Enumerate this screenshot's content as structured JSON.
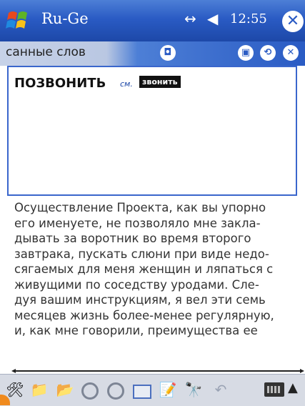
{
  "titlebar": {
    "app_title": "Ru-Ge",
    "time": "12:55",
    "connectivity_icon": "↔",
    "volume_icon": "◀",
    "close_label": "✕"
  },
  "window": {
    "caption": "санные слов"
  },
  "entry": {
    "headword": "ПОЗВОНИТЬ",
    "see_label": "см.",
    "xref": "звонить"
  },
  "body_lines": [
    "Осуществление Проекта, как вы упорно",
    "его именуете, не позволяло мне закла-",
    "дывать за воротник во время второго",
    "завтрака, пускать слюни при виде недо-",
    "сягаемых для меня женщин и ляпаться с",
    "живущими по соседству уродами. Сле-",
    "дуя вашим инструкциям, я вел эти семь",
    "месяцев жизнь более-менее регулярную,",
    "и, как мне говорили, преимущества ее"
  ],
  "toolbar": {
    "icons": [
      "tools-icon",
      "folder-icon",
      "open-icon",
      "circle-icon",
      "circle-icon",
      "window-icon",
      "edit-icon",
      "binoculars-icon",
      "back-icon",
      "keyboard-icon"
    ]
  },
  "colors": {
    "titlebar": "#2a5bc4",
    "entry_border": "#3a66cc",
    "toolbar": "#d7dbe4"
  }
}
